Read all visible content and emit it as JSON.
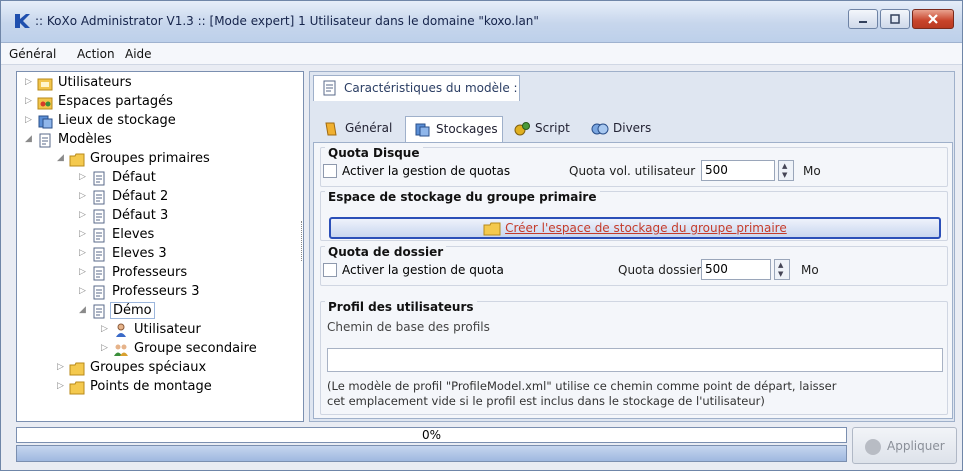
{
  "window": {
    "title": ":: KoXo Administrator V1.3 :: [Mode expert] 1 Utilisateur dans le domaine \"koxo.lan\""
  },
  "menu": [
    "Général",
    "Action",
    "Aide"
  ],
  "tree": [
    {
      "label": "Utilisateurs",
      "icon": "users-folder-icon"
    },
    {
      "label": "Espaces partagés",
      "icon": "shared-folder-icon"
    },
    {
      "label": "Lieux de stockage",
      "icon": "storage-icon"
    },
    {
      "label": "Modèles",
      "icon": "model-icon"
    },
    {
      "label": "Groupes primaires",
      "icon": "folder-icon"
    },
    {
      "label": "Défaut",
      "icon": "document-icon"
    },
    {
      "label": "Défaut 2",
      "icon": "document-icon"
    },
    {
      "label": "Défaut 3",
      "icon": "document-icon"
    },
    {
      "label": "Eleves",
      "icon": "document-icon"
    },
    {
      "label": "Eleves 3",
      "icon": "document-icon"
    },
    {
      "label": "Professeurs",
      "icon": "document-icon"
    },
    {
      "label": "Professeurs 3",
      "icon": "document-icon"
    },
    {
      "label": "Démo",
      "icon": "document-icon"
    },
    {
      "label": "Utilisateur",
      "icon": "user-icon"
    },
    {
      "label": "Groupe secondaire",
      "icon": "group-icon"
    },
    {
      "label": "Groupes spéciaux",
      "icon": "folder-icon"
    },
    {
      "label": "Points de montage",
      "icon": "folder-icon"
    }
  ],
  "panel": {
    "header_tab": "Caractéristiques du modèle :",
    "tabs": [
      "Général",
      "Stockages",
      "Script",
      "Divers"
    ],
    "active_tab": "Stockages"
  },
  "quota_disque": {
    "title": "Quota Disque",
    "checkbox_label": "Activer la gestion de quotas",
    "field_label": "Quota vol. utilisateur",
    "value": "500",
    "unit": "Mo"
  },
  "espace": {
    "title": "Espace de stockage du groupe primaire",
    "button_label": "Créer l'espace de stockage du groupe primaire"
  },
  "quota_dossier": {
    "title": "Quota de dossier",
    "checkbox_label": "Activer la gestion de quota",
    "field_label": "Quota dossier",
    "value": "500",
    "unit": "Mo"
  },
  "profil": {
    "title": "Profil des utilisateurs",
    "path_label": "Chemin de base des profils",
    "path_value": "",
    "note_line1": "(Le modèle de profil \"ProfileModel.xml\" utilise ce chemin comme point de départ, laisser",
    "note_line2": "cet emplacement vide si le profil est inclus dans le stockage de l'utilisateur)"
  },
  "progress": {
    "text": "0%",
    "value": 0
  },
  "apply_label": "Appliquer"
}
